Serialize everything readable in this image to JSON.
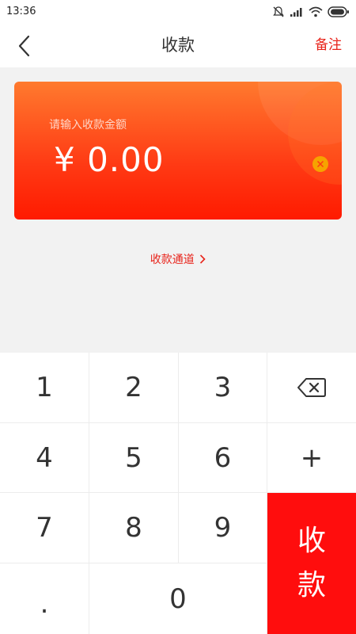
{
  "status_bar": {
    "time": "13:36"
  },
  "header": {
    "title": "收款",
    "note_label": "备注"
  },
  "card": {
    "prompt": "请输入收款金额",
    "amount": "¥ 0.00"
  },
  "channel": {
    "label": "收款通道"
  },
  "keypad": {
    "k1": "1",
    "k2": "2",
    "k3": "3",
    "k4": "4",
    "k5": "5",
    "k6": "6",
    "k7": "7",
    "k8": "8",
    "k9": "9",
    "dot": ".",
    "k0": "0",
    "plus": "+",
    "pay_label": "收款"
  },
  "colors": {
    "accent": "#e8231a",
    "pay": "#ff0d0d",
    "card_top": "#ff7a2e",
    "card_bottom": "#ff1a00",
    "clear": "#f6a300"
  }
}
